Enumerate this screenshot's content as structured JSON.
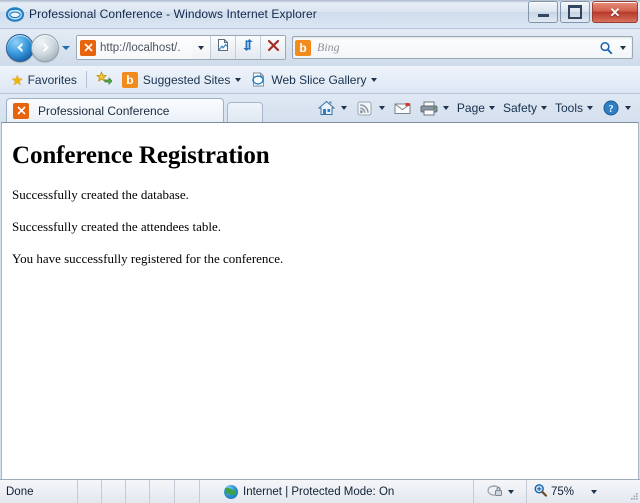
{
  "window": {
    "title": "Professional Conference - Windows Internet Explorer",
    "app_icon": "internet-explorer-icon",
    "minimize_label": "Minimize",
    "maximize_label": "Maximize",
    "close_label": "Close"
  },
  "navbar": {
    "back_label": "Back",
    "forward_label": "Forward",
    "recent_pages_label": "Recent Pages",
    "address_value": "http://localhost/.",
    "address_placeholder": "http://localhost/.",
    "address_dropdown_label": "Address dropdown",
    "compatibility_label": "Compatibility View",
    "refresh_label": "Refresh",
    "stop_label": "Stop",
    "search_placeholder": "Bing",
    "search_value": "",
    "search_provider_icon": "bing-icon",
    "search_go_label": "Search",
    "search_dropdown_label": "Search provider dropdown"
  },
  "favorites_bar": {
    "favorites_label": "Favorites",
    "add_to_favorites_label": "Add to Favorites Bar",
    "items": [
      {
        "label": "Suggested Sites",
        "icon": "bing-icon",
        "has_caret": true
      },
      {
        "label": "Web Slice Gallery",
        "icon": "ie-page-icon",
        "has_caret": true
      }
    ]
  },
  "tabs": {
    "items": [
      {
        "label": "Professional Conference",
        "icon": "site-icon",
        "active": true
      }
    ],
    "new_tab_label": ""
  },
  "command_bar": {
    "home_label": "Home",
    "feeds_label": "Feeds",
    "mail_label": "Read Mail",
    "print_label": "Print",
    "menus": [
      {
        "label": "Page"
      },
      {
        "label": "Safety"
      },
      {
        "label": "Tools"
      }
    ],
    "help_label": "Help"
  },
  "page": {
    "heading": "Conference Registration",
    "paragraphs": [
      "Successfully created the database.",
      "Successfully created the attendees table.",
      "You have successfully registered for the conference."
    ]
  },
  "status_bar": {
    "status_text": "Done",
    "zone_text": "Internet | Protected Mode: On",
    "zone_icon": "globe-icon",
    "privacy_icon": "privacy-report-icon",
    "privacy_dropdown_label": "Privacy options",
    "zoom_icon": "zoom-magnifier-icon",
    "zoom_level": "75%",
    "zoom_dropdown_label": "Change zoom level"
  },
  "colors": {
    "accent_blue": "#1565b0",
    "site_orange": "#e8640c",
    "bing_orange": "#f28b1c",
    "close_red": "#b8392a",
    "chrome_blue": "#dae4f0"
  }
}
